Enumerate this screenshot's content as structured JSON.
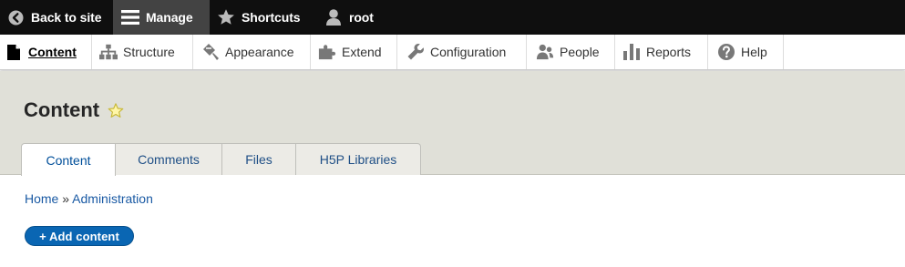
{
  "toolbar": {
    "back_label": "Back to site",
    "manage_label": "Manage",
    "shortcuts_label": "Shortcuts",
    "user_label": "root"
  },
  "tray": {
    "items": [
      {
        "label": "Content",
        "icon": "document-icon"
      },
      {
        "label": "Structure",
        "icon": "sitemap-icon"
      },
      {
        "label": "Appearance",
        "icon": "paint-bucket-icon"
      },
      {
        "label": "Extend",
        "icon": "puzzle-icon"
      },
      {
        "label": "Configuration",
        "icon": "wrench-icon"
      },
      {
        "label": "People",
        "icon": "people-icon"
      },
      {
        "label": "Reports",
        "icon": "bar-chart-icon"
      },
      {
        "label": "Help",
        "icon": "help-icon"
      }
    ]
  },
  "page": {
    "title": "Content"
  },
  "tabs": [
    {
      "label": "Content"
    },
    {
      "label": "Comments"
    },
    {
      "label": "Files"
    },
    {
      "label": "H5P Libraries"
    }
  ],
  "breadcrumb": {
    "home": "Home",
    "separator": "»",
    "admin": "Administration"
  },
  "actions": {
    "add_content": "+ Add content"
  },
  "colors": {
    "toolbar_bg": "#0f0f0f",
    "manage_active_bg": "#434343",
    "header_bg": "#e0e0d8",
    "link": "#1a5aa4",
    "primary_button": "#0a66b3"
  }
}
